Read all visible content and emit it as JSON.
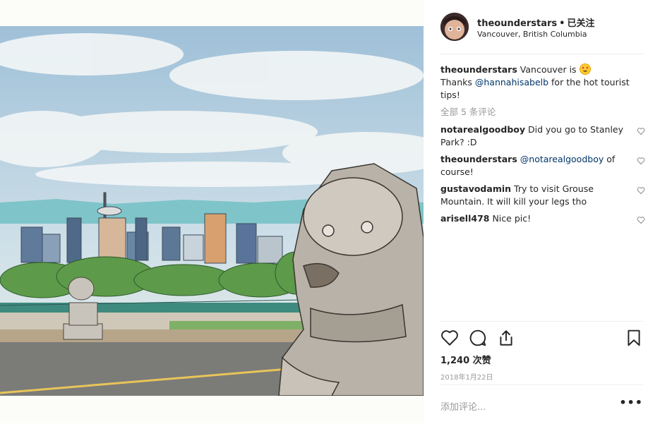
{
  "post": {
    "username": "theounderstars",
    "follow_status": "已关注",
    "location": "Vancouver, British Columbia",
    "image_alt_icon": "city-skyline-lion-statue-illustration"
  },
  "caption": {
    "username": "theounderstars",
    "text_1": "Vancouver is ",
    "emoji": "heart-eyes-emoji",
    "line2_pre": "Thanks ",
    "mention": "@hannahisabelb",
    "line2_post": " for the hot tourist tips!"
  },
  "view_all": "全部 5 条评论",
  "comments": [
    {
      "username": "notarealgoodboy",
      "text": "Did you go to Stanley Park? :D",
      "mention": ""
    },
    {
      "username": "theounderstars",
      "mention": "@notarealgoodboy",
      "text": " of course!"
    },
    {
      "username": "gustavodamin",
      "text": "Try to visit Grouse Mountain. It will kill your legs tho",
      "mention": ""
    },
    {
      "username": "arisell478",
      "text": "Nice pic!",
      "mention": ""
    }
  ],
  "likes": "1,240 次赞",
  "date": "2018年1月22日",
  "add_comment_placeholder": "添加评论...",
  "more_label": "•••",
  "icons": {
    "like": "heart-icon",
    "comment": "comment-icon",
    "share": "share-icon",
    "save": "bookmark-icon"
  }
}
